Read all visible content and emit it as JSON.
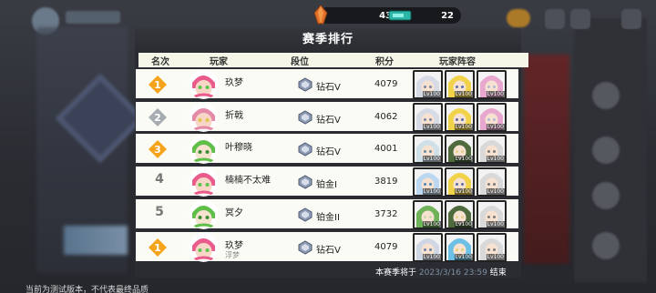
{
  "resources": {
    "crystal": "433",
    "ticket": "22"
  },
  "panel": {
    "title": "赛季排行",
    "columns": [
      "名次",
      "玩家",
      "段位",
      "积分",
      "玩家阵容"
    ]
  },
  "rows": [
    {
      "rank": "1",
      "rank_style": "gold",
      "name": "玖梦",
      "sub": "",
      "tier": "钻石V",
      "score": "4079",
      "avatar_hue": "pink"
    },
    {
      "rank": "2",
      "rank_style": "silver",
      "name": "折戟",
      "sub": "",
      "tier": "钻石V",
      "score": "4062",
      "avatar_hue": "pinkblue"
    },
    {
      "rank": "3",
      "rank_style": "gold",
      "name": "叶穆晓",
      "sub": "",
      "tier": "钻石V",
      "score": "4001",
      "avatar_hue": "green"
    },
    {
      "rank": "4",
      "rank_style": "plain",
      "name": "楠楠不太难",
      "sub": "",
      "tier": "铂金I",
      "score": "3819",
      "avatar_hue": "pink"
    },
    {
      "rank": "5",
      "rank_style": "plain",
      "name": "冥夕",
      "sub": "",
      "tier": "铂金II",
      "score": "3732",
      "avatar_hue": "green"
    },
    {
      "rank": "1",
      "rank_style": "gold",
      "name": "玖梦",
      "sub": "浮梦",
      "tier": "钻石V",
      "score": "4079",
      "avatar_hue": "pink"
    }
  ],
  "hero_levels": [
    "Lv100",
    "Lv100",
    "Lv100"
  ],
  "season_end": {
    "prefix": "本赛季将于",
    "date": "2023/3/16 23:59",
    "suffix": "结束"
  },
  "footer_note": "当前为测试版本，不代表最终品质",
  "colors": {
    "gold_badge": "#f5a31a",
    "silver_badge": "#a7acb3",
    "row_bg": "#fbfbf5",
    "panel_bg": "#2a2c31"
  }
}
